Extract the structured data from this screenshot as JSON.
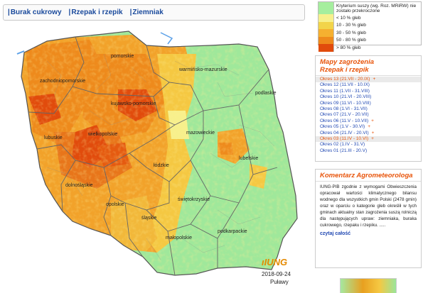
{
  "tabs": [
    "Burak cukrowy",
    "Rzepak i rzepik",
    "Ziemniak"
  ],
  "legend": {
    "items": [
      {
        "label": "Kryterium suszy (wg. Roz. MRiRW) nie zostało przekroczone",
        "color": "#a5ee9e"
      },
      {
        "label": "< 10 % gleb",
        "color": "#f7f08c"
      },
      {
        "label": "10 - 30 % gleb",
        "color": "#f2d44a"
      },
      {
        "label": "30 - 50 % gleb",
        "color": "#f5b030"
      },
      {
        "label": "50 - 80 % gleb",
        "color": "#ee8a1c"
      },
      {
        "label": "> 80 % gleb",
        "color": "#e14b0c"
      }
    ]
  },
  "map": {
    "regions": [
      "pomorskie",
      "warmińsko-mazurskie",
      "zachodniopomorskie",
      "kujawsko-pomorskie",
      "podlaskie",
      "wielkopolskie",
      "mazowieckie",
      "lubuskie",
      "łódzkie",
      "lubelskie",
      "dolnośląskie",
      "opolskie",
      "świętokrzyskie",
      "śląskie",
      "małopolskie",
      "podkarpackie"
    ],
    "date": "2018-09-24",
    "place": "Puławy",
    "logo": "IUNG"
  },
  "threat_panel": {
    "title_line1": "Mapy zagrożenia",
    "title_line2": "Rzepak i rzepik",
    "periods": [
      {
        "label": "Okres 13 (21.VII - 20.IX)",
        "plus": "+",
        "highlight": true
      },
      {
        "label": "Okres 12 (11.VII - 10.IX)",
        "plus": "",
        "highlight": false
      },
      {
        "label": "Okres 11 (1.VII - 31.VIII)",
        "plus": "",
        "highlight": false
      },
      {
        "label": "Okres 10 (21.VI - 20.VIII)",
        "plus": "",
        "highlight": false
      },
      {
        "label": "Okres 09 (11.VI - 10.VIII)",
        "plus": "",
        "highlight": false
      },
      {
        "label": "Okres 08 (1.VI - 31.VII)",
        "plus": "",
        "highlight": false
      },
      {
        "label": "Okres 07 (21.V - 20.VII)",
        "plus": "",
        "highlight": false
      },
      {
        "label": "Okres 06 (11.V - 10.VII)",
        "plus": "+",
        "highlight": false
      },
      {
        "label": "Okres 05 (1.V - 30.VI)",
        "plus": "+",
        "highlight": false
      },
      {
        "label": "Okres 04 (21.IV - 20.VI)",
        "plus": "+",
        "highlight": false
      },
      {
        "label": "Okres 03 (11.IV - 10.VI)",
        "plus": "+",
        "highlight": true
      },
      {
        "label": "Okres 02 (1.IV - 31.V)",
        "plus": "",
        "highlight": false
      },
      {
        "label": "Okres 01 (21.III - 20.V)",
        "plus": "",
        "highlight": false
      }
    ]
  },
  "comment_panel": {
    "title": "Komentarz Agrometeorologa",
    "text": "IUNG-PIB zgodnie z wymogami Obwieszczenia opracował wartości klimatycznego bilansu wodnego dla wszystkich gmin Polski (2478 gmin) oraz w oparciu o kategorie gleb określił w tych gminach aktualny stan zagrożenia suszą rolniczą dla następujących upraw: ziemniaka, buraka cukrowego, rzepaku i rzepiku. .....",
    "more": "czytaj całość"
  }
}
